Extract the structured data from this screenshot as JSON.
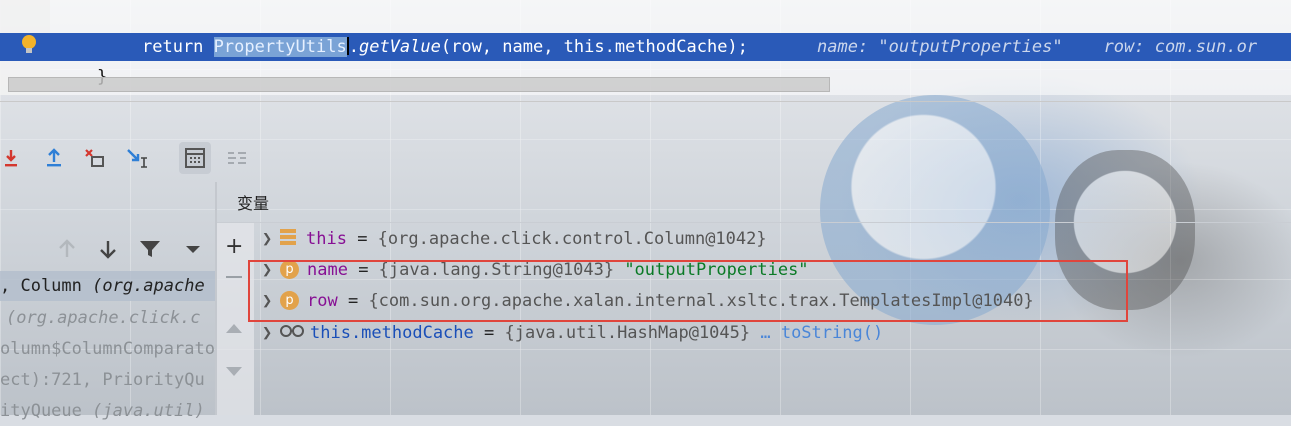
{
  "editor": {
    "code": {
      "keyword": "return ",
      "selected_class": "PropertyUtils",
      "dot": ".",
      "method": "getValue",
      "args": "(row, name, this.methodCache);"
    },
    "inline_hint": "name: \"outputProperties\"    row: com.sun.or",
    "closing_brace": "}"
  },
  "toolbar": {
    "icons": [
      "step-into-icon",
      "step-out-icon",
      "drop-frame-icon",
      "run-to-cursor-icon",
      "evaluate-expression-icon",
      "trace-current-stream-icon"
    ]
  },
  "frames": {
    "tools": [
      "up-arrow-icon",
      "down-arrow-icon",
      "filter-icon",
      "dropdown-icon"
    ],
    "rows": [
      {
        "plain": ", Column ",
        "italic": "(org.apache",
        "selected": true
      },
      {
        "plain": "",
        "italic": "(org.apache.click.c",
        "selected": false
      },
      {
        "plain": "olumn$ColumnComparato",
        "italic": "",
        "selected": false
      },
      {
        "plain": "ect):721, PriorityQu",
        "italic": "",
        "selected": false
      },
      {
        "plain": "ityQueue ",
        "italic": "(java.util)",
        "selected": false
      }
    ]
  },
  "variables": {
    "title": "变量",
    "rows": [
      {
        "name": "this",
        "eq": " = ",
        "type": "{org.apache.click.control.Column@1042}",
        "extra": "",
        "link": ""
      },
      {
        "name": "name",
        "eq": " = ",
        "type": "{java.lang.String@1043}",
        "extra": " \"outputProperties\"",
        "link": ""
      },
      {
        "name": "row",
        "eq": " = ",
        "type": "{com.sun.org.apache.xalan.internal.xsltc.trax.TemplatesImpl@1040}",
        "extra": "",
        "link": ""
      },
      {
        "name": "this.methodCache",
        "eq": " = ",
        "type": "{java.util.HashMap@1045}",
        "extra": "",
        "link": " … toString()"
      }
    ],
    "param_badge": "p"
  },
  "colors": {
    "execution_line": "#2a5ab8",
    "highlight_box": "#e0453c",
    "field_name": "#871094",
    "string_value": "#0a7a26"
  }
}
